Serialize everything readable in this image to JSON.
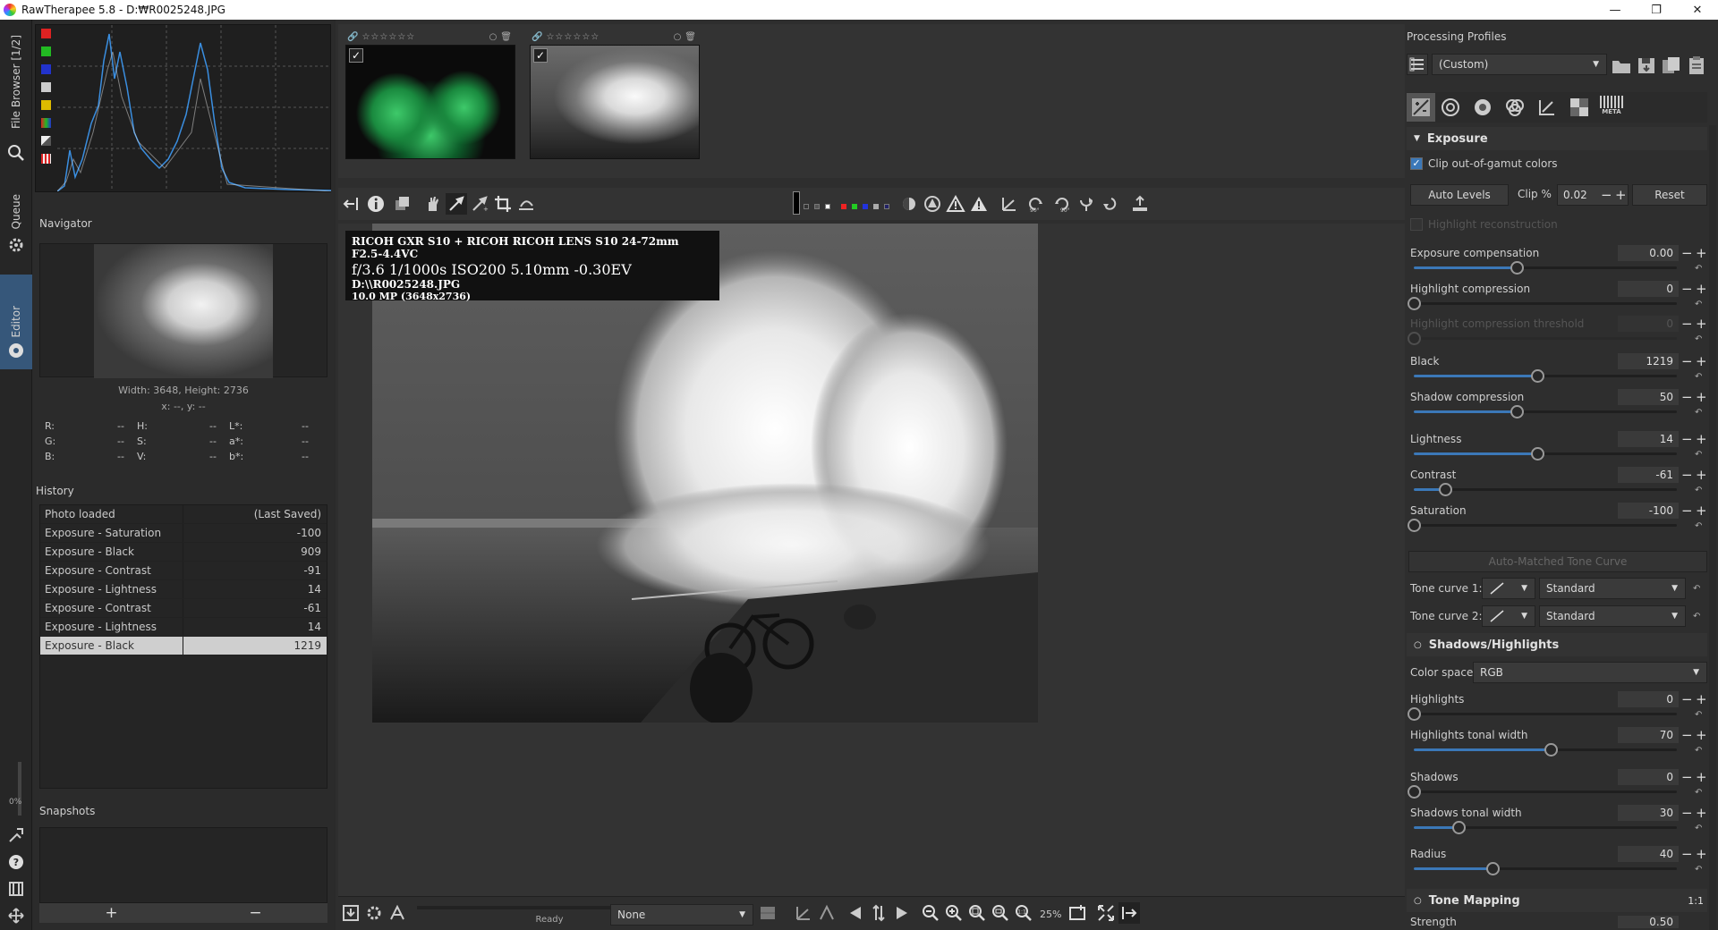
{
  "window": {
    "title": "RawTherapee 5.8 - D:₩R0025248.JPG",
    "min": "—",
    "max": "❐",
    "close": "✕"
  },
  "vtabs": {
    "file_browser": "File Browser [1/2]",
    "queue": "Queue",
    "editor": "Editor",
    "progress": "0%"
  },
  "navigator": {
    "title": "Navigator",
    "size": "Width: 3648, Height: 2736",
    "xy": "x: --, y: --",
    "rows": [
      [
        {
          "k": "R:",
          "v": "--"
        },
        {
          "k": "H:",
          "v": "--"
        },
        {
          "k": "L*:",
          "v": "--"
        }
      ],
      [
        {
          "k": "G:",
          "v": "--"
        },
        {
          "k": "S:",
          "v": "--"
        },
        {
          "k": "a*:",
          "v": "--"
        }
      ],
      [
        {
          "k": "B:",
          "v": "--"
        },
        {
          "k": "V:",
          "v": "--"
        },
        {
          "k": "b*:",
          "v": "--"
        }
      ]
    ]
  },
  "history": {
    "title": "History",
    "rows": [
      {
        "a": "Photo loaded",
        "b": "(Last Saved)"
      },
      {
        "a": "Exposure - Saturation",
        "b": "-100"
      },
      {
        "a": "Exposure - Black",
        "b": "909"
      },
      {
        "a": "Exposure - Contrast",
        "b": "-91"
      },
      {
        "a": "Exposure - Lightness",
        "b": "14"
      },
      {
        "a": "Exposure - Contrast",
        "b": "-61"
      },
      {
        "a": "Exposure - Lightness",
        "b": "14"
      },
      {
        "a": "Exposure - Black",
        "b": "1219"
      }
    ],
    "selected_index": 7
  },
  "snapshots": {
    "title": "Snapshots",
    "add": "+",
    "remove": "−"
  },
  "filmstrip": {
    "stars": "☆☆☆☆☆☆"
  },
  "exif": {
    "camera": "RICOH GXR S10 + RICOH RICOH LENS S10 24-72mm F2.5-4.4VC",
    "settings": "f/3.6  1/1000s  ISO200  5.10mm  -0.30EV",
    "file": "D:\\\\R0025248.JPG",
    "mp": "10.0 MP (3648x2736)"
  },
  "bottom": {
    "status": "Ready",
    "preset": "None",
    "zoom": "25%"
  },
  "right": {
    "profiles_title": "Processing Profiles",
    "profile": "(Custom)",
    "meta_tab": "META",
    "exposure": {
      "title": "Exposure",
      "clip_colors": "Clip out-of-gamut colors",
      "auto_levels": "Auto Levels",
      "clip_label": "Clip %",
      "clip_value": "0.02",
      "reset": "Reset",
      "highlight_reconstruction": "Highlight reconstruction",
      "sliders": [
        {
          "label": "Exposure compensation",
          "value": "0.00",
          "pos": 0.39
        },
        {
          "label": "Highlight compression",
          "value": "0",
          "pos": 0.0
        },
        {
          "label": "Highlight compression threshold",
          "value": "0",
          "pos": 0.0,
          "disabled": true
        },
        {
          "label": "Black",
          "value": "1219",
          "pos": 0.47
        },
        {
          "label": "Shadow compression",
          "value": "50",
          "pos": 0.39
        },
        {
          "label": "Lightness",
          "value": "14",
          "pos": 0.47
        },
        {
          "label": "Contrast",
          "value": "-61",
          "pos": 0.12
        },
        {
          "label": "Saturation",
          "value": "-100",
          "pos": 0.0
        }
      ],
      "auto_matched": "Auto-Matched Tone Curve",
      "tone_curve_1": "Tone curve 1:",
      "tone_curve_2": "Tone curve 2:",
      "tone_mode_1": "Standard",
      "tone_mode_2": "Standard"
    },
    "shadows": {
      "title": "Shadows/Highlights",
      "color_space_label": "Color space:",
      "color_space": "RGB",
      "sliders": [
        {
          "label": "Highlights",
          "value": "0",
          "pos": 0.0
        },
        {
          "label": "Highlights tonal width",
          "value": "70",
          "pos": 0.52
        },
        {
          "label": "Shadows",
          "value": "0",
          "pos": 0.0
        },
        {
          "label": "Shadows tonal width",
          "value": "30",
          "pos": 0.17
        },
        {
          "label": "Radius",
          "value": "40",
          "pos": 0.3
        }
      ]
    },
    "tone_mapping": {
      "title": "Tone Mapping",
      "ratio": "1:1",
      "strength_label": "Strength",
      "strength_value": "0.50"
    }
  }
}
